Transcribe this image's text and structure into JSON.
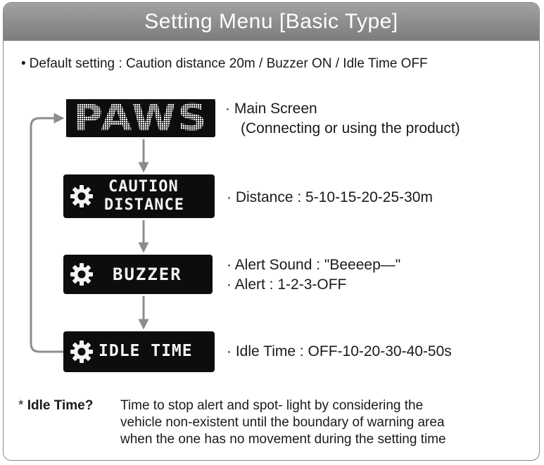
{
  "header": {
    "title": "Setting Menu [Basic Type]"
  },
  "default_setting": "Default setting : Caution distance 20m / Buzzer ON / Idle Time OFF",
  "steps": {
    "main": {
      "screen_text": "PAWS",
      "desc_line1": "· Main Screen",
      "desc_line2": "(Connecting or using the product)"
    },
    "distance": {
      "screen_line1": "CAUTION",
      "screen_line2": "DISTANCE",
      "desc": "· Distance : 5-10-15-20-25-30m"
    },
    "buzzer": {
      "screen_text": "BUZZER",
      "desc_line1": "· Alert Sound : \"Beeeep—\"",
      "desc_line2": "· Alert : 1-2-3-OFF"
    },
    "idle": {
      "screen_text": "IDLE TIME",
      "desc": "· Idle Time : OFF-10-20-30-40-50s"
    }
  },
  "footnote": {
    "marker": "*",
    "term": "Idle Time?",
    "lines": [
      "Time to stop alert and spot- light by considering the",
      "vehicle non-existent until the boundary of warning area",
      "when the one has no movement during the setting time"
    ]
  },
  "colors": {
    "header_bg": "#8e8e8e",
    "screen_bg": "#0d0d0d",
    "arrow": "#8c8c8c",
    "text": "#1a1a1a"
  },
  "icons": {
    "settings": "gear-icon"
  }
}
